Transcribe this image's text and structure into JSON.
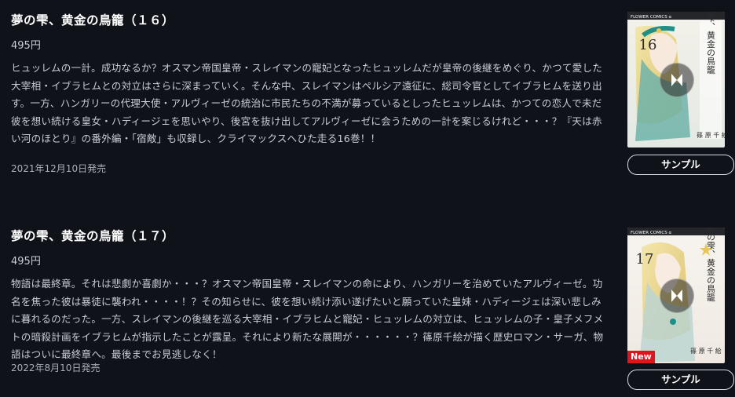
{
  "volumes": [
    {
      "title": "夢の雫、黄金の鳥籠（１６）",
      "price": "495円",
      "description": "ヒュッレムの一計。成功なるか？オスマン帝国皇帝・スレイマンの寵妃となったヒュッレムだが皇帝の後継をめぐり、かつて愛した大宰相・イブラヒムとの対立はさらに深まっていく。そんな中、スレイマンはペルシア遠征に、総司令官としてイブラヒムを送り出す。一方、ハンガリーの代理大使・アルヴィーゼの統治に市民たちの不満が募っているとしったヒュッレムは、かつての恋人で未だ彼を想い続ける皇女・ハディージェを思いやり、後宮を抜け出してアルヴィーゼに会うための一計を案じるけれど・・・？『天は赤い河のほとり』の番外編・「宿敵」も収録し、クライマックスへひた走る16巻！！",
      "release_date": "2021年12月10日発売",
      "sample_label": "サンプル",
      "cover": {
        "volume_number": "16",
        "author": "篠 原 千 絵",
        "series_title": "夢の雫、黄金の鳥籠",
        "publisher": "FLOWER COMICS α"
      }
    },
    {
      "title": "夢の雫、黄金の鳥籠（１７）",
      "price": "495円",
      "description": "物語は最終章。それは悲劇か喜劇か・・・？オスマン帝国皇帝・スレイマンの命により、ハンガリーを治めていたアルヴィーゼ。功名を焦った彼は暴徒に襲われ・・・・！？その知らせに、彼を想い続け添い遂げたいと願っていた皇妹・ハディージェは深い悲しみに暮れるのだった。一方、スレイマンの後継を巡る大宰相・イブラヒムと寵妃・ヒュッレムの対立は、ヒュッレムの子・皇子メフメトの暗殺計画をイブラヒムが指示したことが露呈。それにより新たな展開が・・・・・・？篠原千絵が描く歴史ロマン・サーガ、物語はついに最終章へ。最後までお見逃しなく！",
      "release_date": "2022年8月10日発売",
      "sample_label": "サンプル",
      "badge": "New",
      "cover": {
        "volume_number": "17",
        "author": "篠 原 千 絵",
        "series_title": "夢の雫、黄金の鳥籠",
        "publisher": "FLOWER COMICS α"
      }
    }
  ],
  "colors": {
    "background": "#0f1218",
    "new_badge": "#e0141e"
  },
  "icons": {
    "play": "play-icon"
  }
}
